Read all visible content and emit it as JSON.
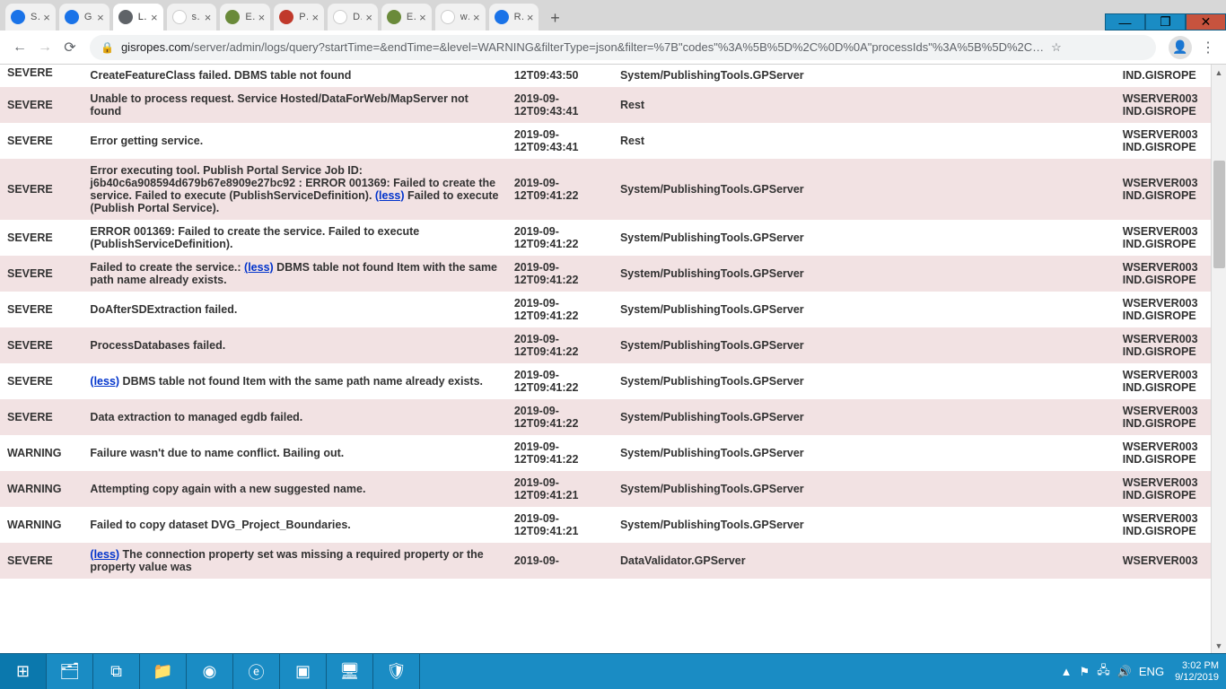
{
  "window": {
    "minimize": "—",
    "maximize": "❐",
    "close": "✕"
  },
  "tabs": [
    {
      "label": "Sign in to",
      "fav": "fav-blue"
    },
    {
      "label": "Generate",
      "fav": "fav-blue"
    },
    {
      "label": "Log Resou",
      "fav": "fav-grey",
      "active": true
    },
    {
      "label": "severe err",
      "fav": "fav-g"
    },
    {
      "label": "Error: ERR",
      "fav": "fav-esri"
    },
    {
      "label": "Package s",
      "fav": "fav-red"
    },
    {
      "label": "Delete the",
      "fav": "fav-g"
    },
    {
      "label": "ERROR: \"A",
      "fav": "fav-esri"
    },
    {
      "label": "web map",
      "fav": "fav-g"
    },
    {
      "label": "ROPeS En",
      "fav": "fav-blue"
    }
  ],
  "toolbar": {
    "back": "←",
    "forward": "→",
    "reload": "⟳",
    "url_host": "gisropes.com",
    "url_rest": "/server/admin/logs/query?startTime=&endTime=&level=WARNING&filterType=json&filter=%7B\"codes\"%3A%5B%5D%2C%0D%0A\"processIds\"%3A%5B%5D%2C…",
    "star": "☆",
    "menu": "⋮"
  },
  "logs": [
    {
      "level": "SEVERE",
      "msg": "CreateFeatureClass failed. DBMS table not found",
      "time": "12T09:43:50",
      "src": "System/PublishingTools.GPServer",
      "mach": "IND.GISROPE",
      "cut": true
    },
    {
      "level": "SEVERE",
      "msg": "Unable to process request. Service Hosted/DataForWeb/MapServer not found",
      "time": "2019-09-12T09:43:41",
      "src": "Rest",
      "mach": "WSERVER003 IND.GISROPE"
    },
    {
      "level": "SEVERE",
      "msg": "Error getting service.",
      "time": "2019-09-12T09:43:41",
      "src": "Rest",
      "mach": "WSERVER003 IND.GISROPE"
    },
    {
      "level": "SEVERE",
      "msg_pre": "Error executing tool. Publish Portal Service Job ID: j6b40c6a908594d679b67e8909e27bc92 : ERROR 001369: Failed to create the service. Failed to execute (PublishServiceDefinition). ",
      "link": "(less)",
      "msg_post": " Failed to execute (Publish Portal Service).",
      "time": "2019-09-12T09:41:22",
      "src": "System/PublishingTools.GPServer",
      "mach": "WSERVER003 IND.GISROPE"
    },
    {
      "level": "SEVERE",
      "msg": "ERROR 001369: Failed to create the service. Failed to execute (PublishServiceDefinition).",
      "time": "2019-09-12T09:41:22",
      "src": "System/PublishingTools.GPServer",
      "mach": "WSERVER003 IND.GISROPE"
    },
    {
      "level": "SEVERE",
      "msg_pre": "Failed to create the service.: ",
      "link": "(less)",
      "msg_post": " DBMS table not found Item with the same path name already exists.",
      "time": "2019-09-12T09:41:22",
      "src": "System/PublishingTools.GPServer",
      "mach": "WSERVER003 IND.GISROPE"
    },
    {
      "level": "SEVERE",
      "msg": "DoAfterSDExtraction failed.",
      "time": "2019-09-12T09:41:22",
      "src": "System/PublishingTools.GPServer",
      "mach": "WSERVER003 IND.GISROPE"
    },
    {
      "level": "SEVERE",
      "msg": "ProcessDatabases failed.",
      "time": "2019-09-12T09:41:22",
      "src": "System/PublishingTools.GPServer",
      "mach": "WSERVER003 IND.GISROPE"
    },
    {
      "level": "SEVERE",
      "link": "(less)",
      "msg_post": " DBMS table not found Item with the same path name already exists.",
      "time": "2019-09-12T09:41:22",
      "src": "System/PublishingTools.GPServer",
      "mach": "WSERVER003 IND.GISROPE"
    },
    {
      "level": "SEVERE",
      "msg": "Data extraction to managed egdb failed.",
      "time": "2019-09-12T09:41:22",
      "src": "System/PublishingTools.GPServer",
      "mach": "WSERVER003 IND.GISROPE"
    },
    {
      "level": "WARNING",
      "msg": "Failure wasn't due to name conflict. Bailing out.",
      "time": "2019-09-12T09:41:22",
      "src": "System/PublishingTools.GPServer",
      "mach": "WSERVER003 IND.GISROPE"
    },
    {
      "level": "WARNING",
      "msg": "Attempting copy again with a new suggested name.",
      "time": "2019-09-12T09:41:21",
      "src": "System/PublishingTools.GPServer",
      "mach": "WSERVER003 IND.GISROPE"
    },
    {
      "level": "WARNING",
      "msg": "Failed to copy dataset DVG_Project_Boundaries.",
      "time": "2019-09-12T09:41:21",
      "src": "System/PublishingTools.GPServer",
      "mach": "WSERVER003 IND.GISROPE"
    },
    {
      "level": "SEVERE",
      "link": "(less)",
      "msg_post": " The connection property set was missing a required property or the property value was",
      "time": "2019-09-",
      "src": "DataValidator.GPServer",
      "mach": "WSERVER003",
      "cutbottom": true
    }
  ],
  "taskbar": {
    "start": "⊞",
    "icons": [
      "🗂",
      "⧉",
      "📁",
      "◉",
      "ⓔ",
      "▣",
      "🖥",
      "🛡"
    ],
    "tray_up": "▲",
    "tray_lang": "ENG",
    "time": "3:02 PM",
    "date": "9/12/2019"
  }
}
